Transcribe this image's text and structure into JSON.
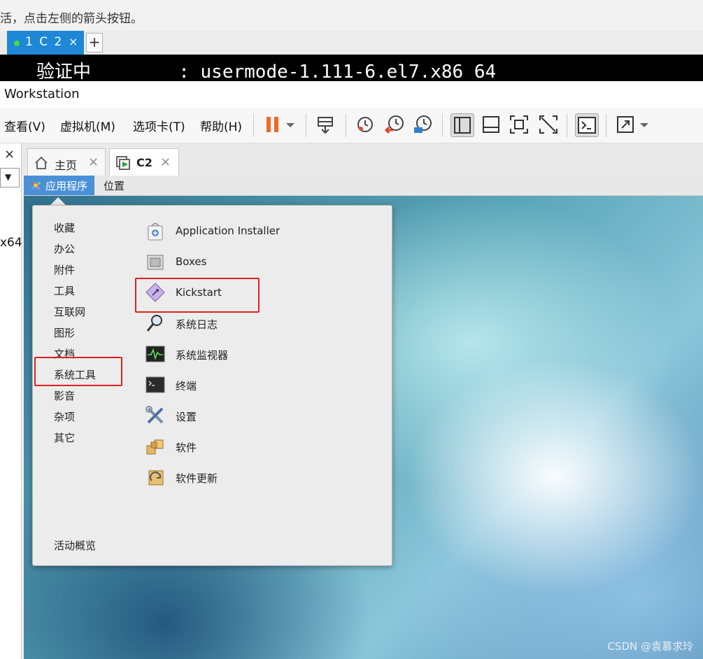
{
  "hint": "活，点击左侧的箭头按钮。",
  "terminal": {
    "tab_label": "1 C 2",
    "close": "×",
    "add": "+",
    "line": "验证中        : usermode-1.111-6.el7.x86_64"
  },
  "workstation_title": "Workstation",
  "menus": [
    "查看(V)",
    "虚拟机(M)",
    "选项卡(T)",
    "帮助(H)"
  ],
  "toolbar_icons": [
    "pause-icon",
    "dropdown-icon",
    "send-keys-icon",
    "snapshot-icon",
    "revert-snapshot-icon",
    "manage-snapshot-icon",
    "library-icon",
    "thumbnail-icon",
    "fullscreen-icon",
    "unity-icon",
    "console-icon",
    "stretch-icon",
    "dropdown-icon"
  ],
  "left_panel": {
    "close": "×",
    "fragment": "x64"
  },
  "vm_tabs": [
    {
      "label": "主页",
      "icon": "home-icon",
      "close": "×"
    },
    {
      "label": "C2",
      "icon": "vm-running-icon",
      "close": "×"
    }
  ],
  "guest": {
    "app_menu": "应用程序",
    "places": "位置",
    "categories": [
      "收藏",
      "办公",
      "附件",
      "工具",
      "互联网",
      "图形",
      "文档",
      "系统工具",
      "影音",
      "杂项",
      "其它"
    ],
    "activities": "活动概览",
    "apps": [
      {
        "label": "Application Installer",
        "icon": "installer-bag-icon"
      },
      {
        "label": "Boxes",
        "icon": "boxes-icon"
      },
      {
        "label": "Kickstart",
        "icon": "kickstart-icon"
      },
      {
        "label": "系统日志",
        "icon": "magnifier-icon"
      },
      {
        "label": "系统监视器",
        "icon": "monitor-icon"
      },
      {
        "label": "终端",
        "icon": "terminal-icon"
      },
      {
        "label": "设置",
        "icon": "wrench-screwdriver-icon"
      },
      {
        "label": "软件",
        "icon": "software-package-icon"
      },
      {
        "label": "软件更新",
        "icon": "software-update-icon"
      }
    ],
    "highlight_color": "#e02020"
  },
  "watermark": "CSDN @袁慕求玲",
  "colors": {
    "accent": "#1e88d6",
    "app_menu_bg": "#4a90d9",
    "pause": "#f06a23"
  }
}
